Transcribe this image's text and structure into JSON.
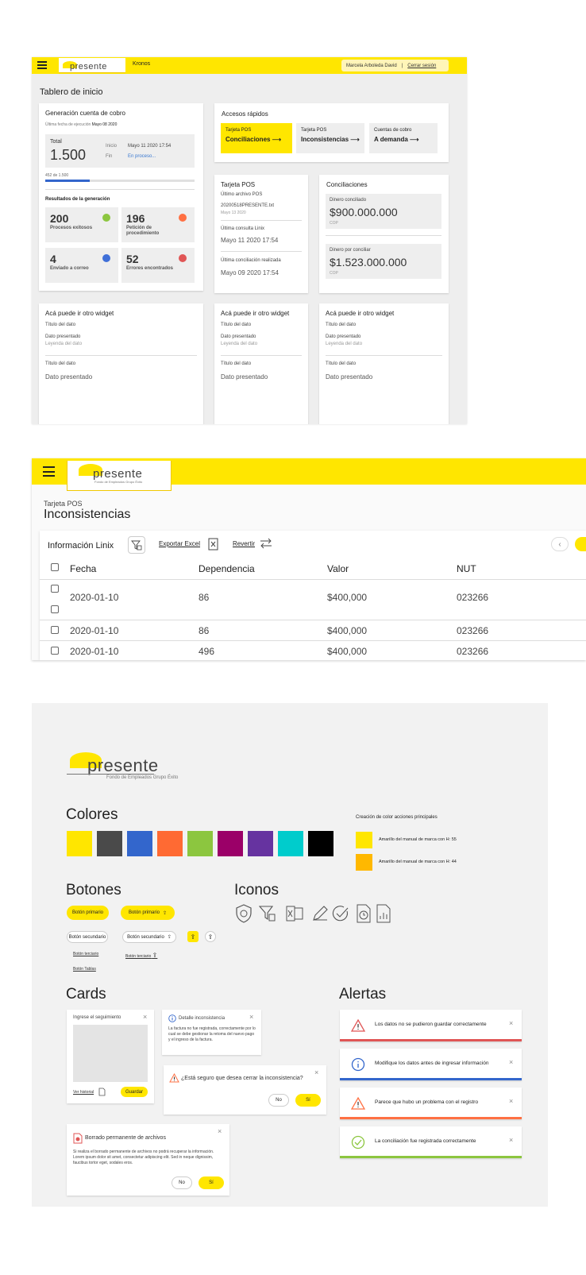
{
  "dashboard": {
    "app_name": "Kronos",
    "user_name": "Marcela Arboleda David",
    "separator": "|",
    "logout": "Cerrar sesión",
    "logo_word": "presente",
    "logo_sub": "Fondo de Empleados Grupo Éxito",
    "page_title": "Tablero de inicio",
    "generacion": {
      "title": "Generación cuenta de cobro",
      "last_run_label": "Última fecha de ejecución",
      "last_run_value": "Mayo 08 2020",
      "total_label": "Total",
      "total_value": "1.500",
      "inicio_label": "Inicio",
      "inicio_value": "Mayo 11 2020 17:54",
      "fin_label": "Fin",
      "fin_value": "En proceso...",
      "progress_text": "452 de 1.500",
      "progress_fraction": 0.3,
      "results_title": "Resultados de la generación",
      "results": [
        {
          "value": "200",
          "label": "Procesos exitosos",
          "color": "#8CC63F"
        },
        {
          "value": "196",
          "label": "Petición de procedimiento",
          "color": "#FF7043"
        },
        {
          "value": "4",
          "label": "Enviado a correo",
          "color": "#3F6FD8"
        },
        {
          "value": "52",
          "label": "Errores encontrados",
          "color": "#E05555"
        }
      ]
    },
    "accesos": {
      "title": "Accesos rápidos",
      "items": [
        {
          "sub": "Tarjeta POS",
          "label": "Conciliaciones ⟶"
        },
        {
          "sub": "Tarjeta POS",
          "label": "Inconsistencias ⟶"
        },
        {
          "sub": "Cuentas de cobro",
          "label": "A demanda ⟶"
        }
      ]
    },
    "tarjeta_pos": {
      "title": "Tarjeta POS",
      "file_label": "Último archivo POS",
      "file_name": "20200518PRESENTE.txt",
      "file_date": "Mayo 13 2020",
      "consulta_label": "Última consulta Linix",
      "consulta_value": "Mayo 11 2020 17:54",
      "conciliacion_label": "Última conciliación realizada",
      "conciliacion_value": "Mayo 09 2020 17:54"
    },
    "conciliaciones": {
      "title": "Conciliaciones",
      "conciliado_label": "Dinero conciliado",
      "conciliado_value": "$900.000.000",
      "conciliado_cur": "COP",
      "por_conciliar_label": "Dinero por conciliar",
      "por_conciliar_value": "$1.523.000.000",
      "por_conciliar_cur": "COP"
    },
    "widget": {
      "title": "Acá puede ir otro widget",
      "dato_title": "Título del dato",
      "dato_value": "Dato presentado",
      "dato_legend": "Leyenda del dato"
    }
  },
  "inconsistencias": {
    "breadcrumb": "Tarjeta POS",
    "title": "Inconsistencias",
    "toolbar_title": "Información Linix",
    "export_label": "Exportar Excel",
    "revert_label": "Revertir",
    "columns": [
      "Fecha",
      "Dependencia",
      "Valor",
      "NUT"
    ],
    "rows": [
      [
        "2020-01-10",
        "86",
        "$400,000",
        "023266"
      ],
      [
        "2020-01-10",
        "86",
        "$400,000",
        "023266"
      ],
      [
        "2020-01-10",
        "496",
        "$400,000",
        "023266"
      ]
    ]
  },
  "guide": {
    "colores_title": "Colores",
    "swatches": [
      "#FFE600",
      "#4A4A4A",
      "#3366CC",
      "#FF6A33",
      "#8CC63F",
      "#9B0068",
      "#6633A0",
      "#00CCCC",
      "#000000"
    ],
    "creation_title": "Creación de color acciones principales",
    "creation_items": [
      {
        "color": "#FFE600",
        "text": "Amarillo del manual de marca con H: 55"
      },
      {
        "color": "#FFB800",
        "text": "Amarillo del manual de marca con H: 44"
      }
    ],
    "botones_title": "Botones",
    "btn_primary": "Botón primario",
    "btn_secondary": "Botón secundario",
    "btn_tertiary": "Botón terciario",
    "btn_tablas": "Botón Tablas",
    "iconos_title": "Iconos",
    "cards_title": "Cards",
    "card_seguimiento": {
      "title": "Ingrese el seguimiento",
      "link": "Ver historial",
      "save": "Guardar"
    },
    "card_detalle": {
      "title": "Detalle inconsistencia",
      "body": "La factura no fue registrada, correctamente por lo cual se debe gestionar la retoma del nuevo pago y el ingreso de la factura."
    },
    "card_confirm": {
      "title": "¿Está seguro que desea cerrar la inconsistencia?",
      "no": "No",
      "si": "Sí"
    },
    "card_borrado": {
      "title": "Borrado permanente de archivos",
      "body": "Si realiza el borrado permanente de archivos no podrá recuperar la información. Lorem ipsum dolor sit amet, consectetur adipiscing elit. Sed in neque dignissim, faucibus tortor eget, sodales eros.",
      "no": "No",
      "si": "Sí"
    },
    "alertas_title": "Alertas",
    "alerts": [
      {
        "text": "Los datos no se pudieron guardar correctamente",
        "color": "#E05555",
        "icon": "warning-icon"
      },
      {
        "text": "Modifique los datos antes de ingresar información",
        "color": "#3366CC",
        "icon": "info-icon"
      },
      {
        "text": "Parece que hubo un problema con el registro",
        "color": "#FF7043",
        "icon": "warning-icon"
      },
      {
        "text": "La conciliación fue registrada correctamente",
        "color": "#8CC63F",
        "icon": "check-icon"
      }
    ]
  }
}
